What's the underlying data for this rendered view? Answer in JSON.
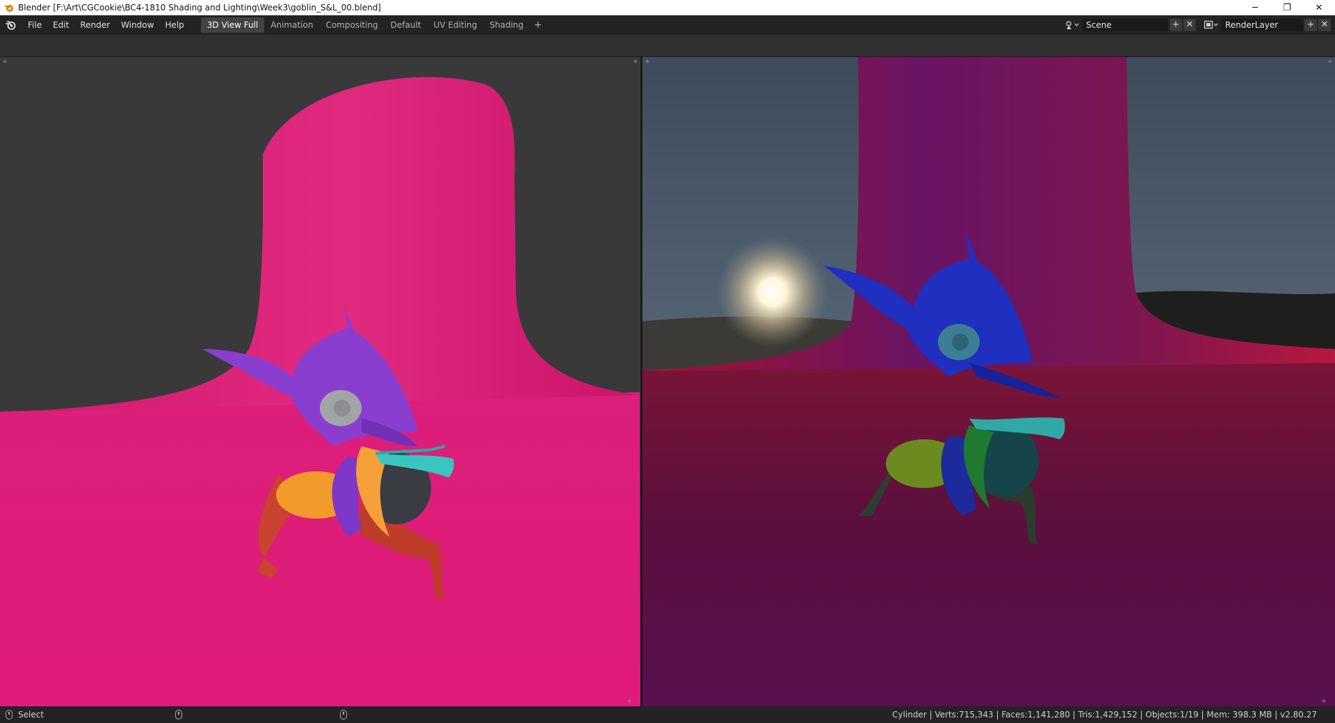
{
  "window": {
    "title": "Blender [F:\\Art\\CGCookie\\BC4-1810 Shading and Lighting\\Week3\\goblin_S&L_00.blend]",
    "controls": {
      "minimize": "─",
      "restore": "❐",
      "close": "✕"
    }
  },
  "menu": {
    "items": [
      "File",
      "Edit",
      "Render",
      "Window",
      "Help"
    ]
  },
  "workspaces": {
    "tabs": [
      "3D View Full",
      "Animation",
      "Compositing",
      "Default",
      "UV Editing",
      "Shading"
    ],
    "active_index": 0,
    "add_label": "+"
  },
  "scene": {
    "name": "Scene",
    "add_label": "+",
    "remove_label": "✕"
  },
  "render_layer": {
    "name": "RenderLayer",
    "add_label": "+",
    "remove_label": "✕"
  },
  "status_bar": {
    "action_label": "Select",
    "stats": "Cylinder | Verts:715,343 | Faces:1,141,280 | Tris:1,429,152 | Objects:1/19 | Mem: 398.3 MB | v2.80.27"
  },
  "viewports": {
    "left": {
      "shading": "solid",
      "backdrop_color": "#393939",
      "object_color": "#dc1e78"
    },
    "right": {
      "shading": "rendered",
      "sky_color": "#4a5a6c",
      "object_color": "#9a1540"
    }
  },
  "icons": {
    "app": "blender-icon",
    "scene": "scene-icon",
    "render_layer": "render-layer-icon",
    "mouse": "mouse-icon"
  }
}
